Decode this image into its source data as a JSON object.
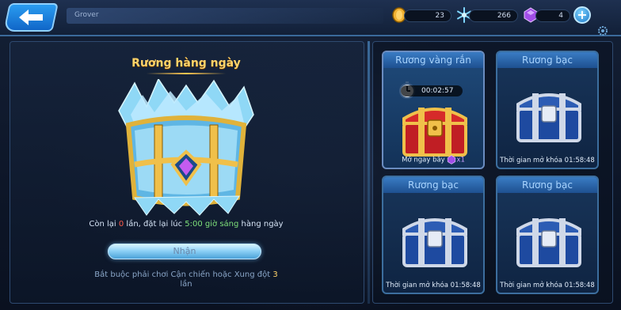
{
  "header": {
    "player_name": "Grover",
    "gold": "23",
    "crystal": "266",
    "gem": "4"
  },
  "daily_chest": {
    "title": "Rương hàng ngày",
    "remaining_prefix": "Còn lại ",
    "remaining_count": "0",
    "remaining_mid": " lần, đặt lại lúc ",
    "reset_time": "5:00 giờ sáng",
    "remaining_suffix": " hàng ngày",
    "claim_label": "Nhận",
    "requirement_text": "Bắt buộc phải chơi Cận chiến hoặc Xung đột ",
    "requirement_count": "3",
    "requirement_unit": "lần"
  },
  "chest_slots": [
    {
      "name": "Rương vàng rắn",
      "timer": "00:02:57",
      "footer": "Mở ngay bây",
      "cost": "x1"
    },
    {
      "name": "Rương bạc",
      "footer": "Thời gian mở khóa 01:58:48"
    },
    {
      "name": "Rương bạc",
      "footer": "Thời gian mở khóa 01:58:48"
    },
    {
      "name": "Rương bạc",
      "footer": "Thời gian mở khóa 01:58:48"
    }
  ],
  "icons": {
    "back": "back-arrow-icon",
    "gold": "gold-coin-icon",
    "crystal": "snowflake-crystal-icon",
    "gem": "purple-gem-icon",
    "add": "plus-icon",
    "settings": "gear-icon",
    "timer": "stopwatch-icon"
  },
  "colors": {
    "accent": "#2a9cf0",
    "gold_text": "#ffd36a",
    "warn": "#ff5a4a",
    "ok": "#7ee07a"
  }
}
